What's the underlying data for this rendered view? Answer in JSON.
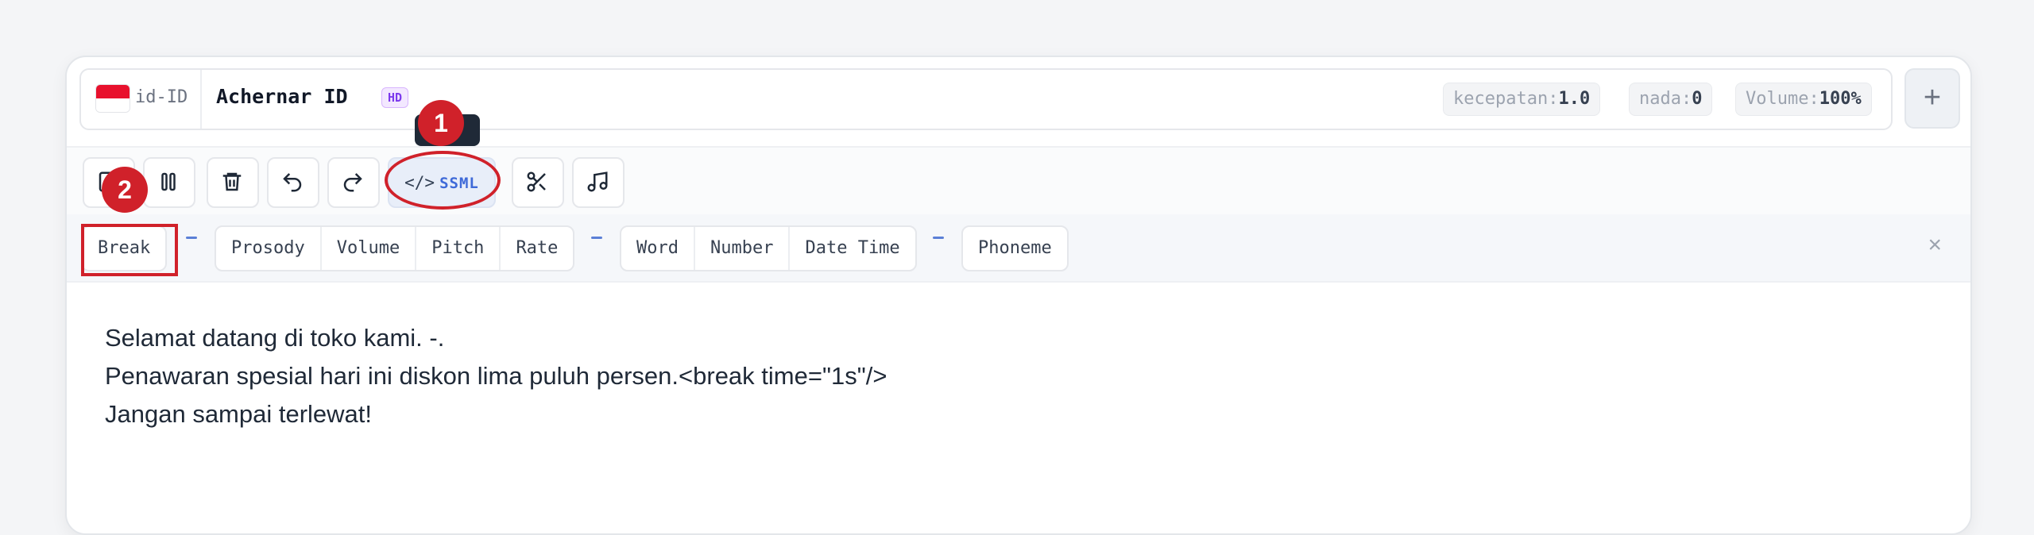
{
  "voice": {
    "language_code": "id-ID",
    "name": "Achernar ID",
    "badge": "HD",
    "params": [
      {
        "key": "kecepatan:",
        "value": "1.0"
      },
      {
        "key": "nada:",
        "value": "0"
      },
      {
        "key": "Volume:",
        "value": "100%"
      }
    ],
    "add_label": "+"
  },
  "toolbar": {
    "buttons": [
      "upload-icon",
      "pause-icon",
      "trash-icon",
      "undo-icon",
      "redo-icon",
      "scissors-icon",
      "music-icon"
    ],
    "ssml_label": "SSML",
    "ssml_tag_glyph": "</>"
  },
  "annotations": {
    "marker1": "1",
    "marker2": "2"
  },
  "ssml_tags": {
    "break": "Break",
    "prosody_group": [
      "Prosody",
      "Volume",
      "Pitch",
      "Rate"
    ],
    "say_as_group": [
      "Word",
      "Number",
      "Date Time"
    ],
    "phoneme": "Phoneme",
    "close": "×"
  },
  "editor": {
    "lines": [
      "Selamat datang di toko kami. -.",
      "Penawaran spesial hari ini diskon lima puluh persen.<break time=\"1s\"/>",
      "Jangan sampai terlewat!"
    ]
  },
  "colors": {
    "accent": "#3f6ad8",
    "annotation_red": "#d0212a",
    "flag_red": "#e8112d"
  }
}
